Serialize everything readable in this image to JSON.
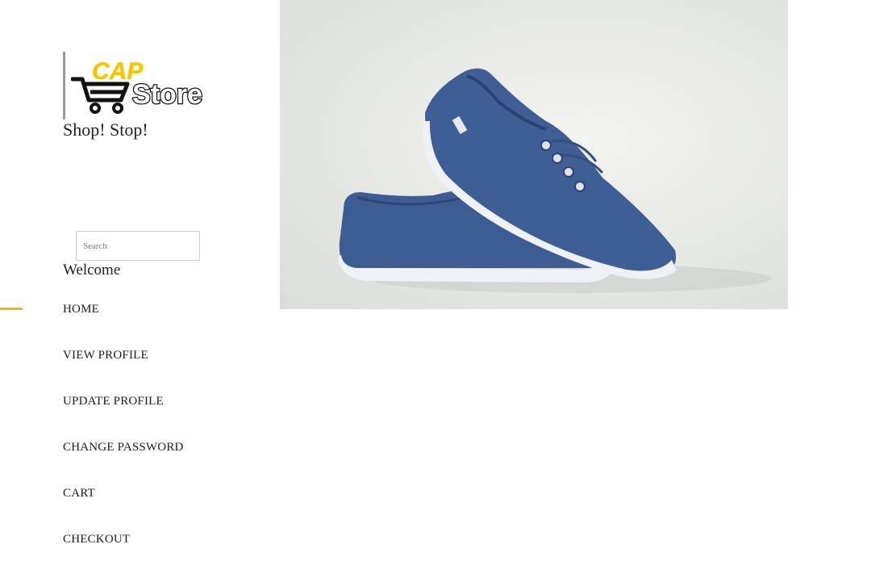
{
  "brand": {
    "logo_text_top": "CAP",
    "logo_text_main": "Store",
    "tagline": "Shop! Stop!",
    "colors": {
      "logo_yellow": "#f7c600",
      "logo_black": "#111111",
      "accent": "#f2b705"
    }
  },
  "search": {
    "placeholder": "Search",
    "value": ""
  },
  "welcome_text": "Welcome",
  "nav": {
    "active_index": 0,
    "items": [
      {
        "label": "HOME"
      },
      {
        "label": "VIEW PROFILE"
      },
      {
        "label": "UPDATE PROFILE"
      },
      {
        "label": "CHANGE PASSWORD"
      },
      {
        "label": "CART"
      },
      {
        "label": "CHECKOUT"
      }
    ]
  },
  "hero": {
    "icon": "blue-sneakers-photo"
  }
}
